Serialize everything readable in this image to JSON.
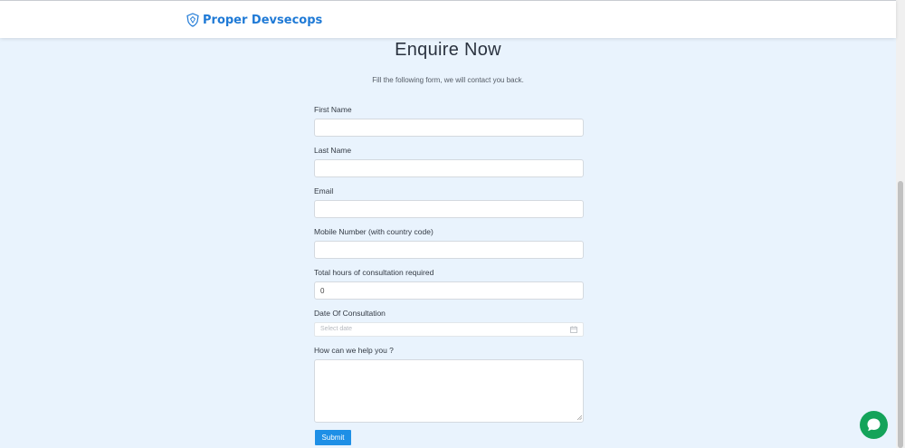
{
  "header": {
    "brand_name": "Proper Devsecops",
    "brand_icon": "shield-icon",
    "brand_color": "#1f7ad6"
  },
  "main": {
    "title": "Enquire Now",
    "subtitle": "Fill the following form, we will contact you back."
  },
  "form": {
    "first_name": {
      "label": "First Name",
      "value": ""
    },
    "last_name": {
      "label": "Last Name",
      "value": ""
    },
    "email": {
      "label": "Email",
      "value": ""
    },
    "mobile": {
      "label": "Mobile Number (with country code)",
      "value": ""
    },
    "hours": {
      "label": "Total hours of consultation required",
      "value": "0"
    },
    "date": {
      "label": "Date Of Consultation",
      "placeholder": "Select date",
      "icon": "calendar-icon"
    },
    "message": {
      "label": "How can we help you ?",
      "value": ""
    },
    "submit_label": "Submit",
    "submit_color": "#1e8fe6"
  },
  "chat": {
    "icon": "chat-bubble-icon",
    "color": "#14a35a"
  }
}
